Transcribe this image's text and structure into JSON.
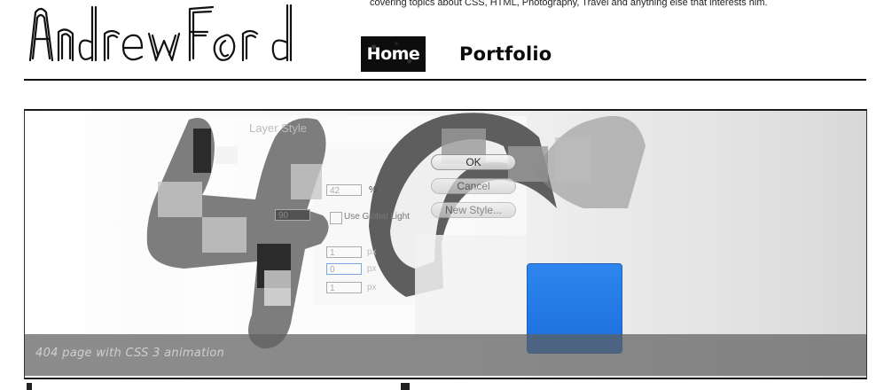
{
  "site": {
    "logo_text": "AndrewFord",
    "tagline": "covering topics about CSS, HTML, Photography, Travel and anything else that interests him."
  },
  "nav": [
    {
      "label": "Home",
      "active": true
    },
    {
      "label": "Portfolio",
      "active": false
    }
  ],
  "featured": {
    "caption": "404 page with CSS 3 animation",
    "dialog": {
      "title": "Layer Style",
      "buttons": [
        "OK",
        "Cancel",
        "New Style..."
      ],
      "opacity_value": "42",
      "opacity_unit": "%",
      "angle_value": "90",
      "global_light_label": "Use Global Light",
      "distance_value": "1",
      "spread_value": "0",
      "size_value": "1",
      "px_unit": "px"
    }
  },
  "colors": {
    "accent_blue": "#1f72e0",
    "caption_bar": "#5f5f5f",
    "ink": "#111111"
  }
}
